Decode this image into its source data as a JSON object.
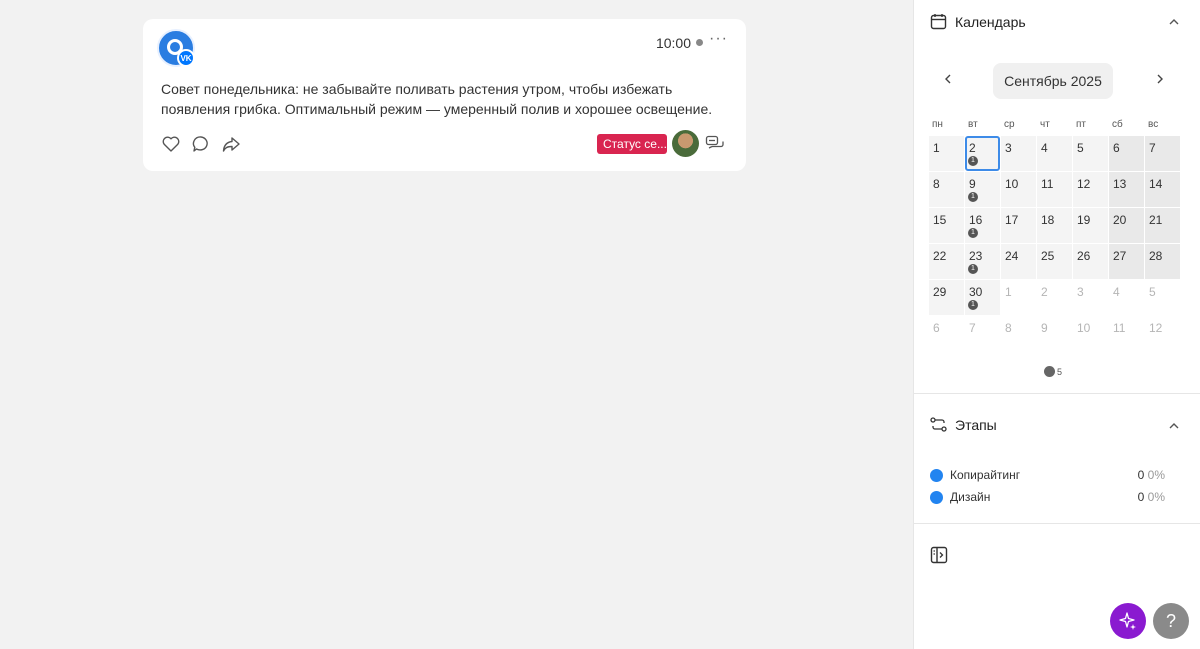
{
  "post": {
    "time": "10:00",
    "more_label": "···",
    "text": "Совет понедельника: не забывайте поливать растения утром, чтобы избежать появления грибка. Оптимальный режим — умеренный полив и хорошее освещение.",
    "status_label": "Статус се...",
    "network_badge": "VK"
  },
  "calendar": {
    "title": "Календарь",
    "month": "Сентябрь 2025",
    "weekdays": [
      "пн",
      "вт",
      "ср",
      "чт",
      "пт",
      "сб",
      "вс"
    ],
    "weeks": [
      [
        {
          "d": "1"
        },
        {
          "d": "2",
          "c": "1",
          "today": true
        },
        {
          "d": "3"
        },
        {
          "d": "4"
        },
        {
          "d": "5"
        },
        {
          "d": "6",
          "we": true
        },
        {
          "d": "7",
          "we": true
        }
      ],
      [
        {
          "d": "8"
        },
        {
          "d": "9",
          "c": "1"
        },
        {
          "d": "10"
        },
        {
          "d": "11"
        },
        {
          "d": "12"
        },
        {
          "d": "13",
          "we": true
        },
        {
          "d": "14",
          "we": true
        }
      ],
      [
        {
          "d": "15"
        },
        {
          "d": "16",
          "c": "1"
        },
        {
          "d": "17"
        },
        {
          "d": "18"
        },
        {
          "d": "19"
        },
        {
          "d": "20",
          "we": true
        },
        {
          "d": "21",
          "we": true
        }
      ],
      [
        {
          "d": "22"
        },
        {
          "d": "23",
          "c": "1"
        },
        {
          "d": "24"
        },
        {
          "d": "25"
        },
        {
          "d": "26"
        },
        {
          "d": "27",
          "we": true
        },
        {
          "d": "28",
          "we": true
        }
      ],
      [
        {
          "d": "29"
        },
        {
          "d": "30",
          "c": "1"
        },
        {
          "d": "1",
          "o": true
        },
        {
          "d": "2",
          "o": true
        },
        {
          "d": "3",
          "o": true
        },
        {
          "d": "4",
          "o": true
        },
        {
          "d": "5",
          "o": true
        }
      ],
      [
        {
          "d": "6",
          "o": true
        },
        {
          "d": "7",
          "o": true
        },
        {
          "d": "8",
          "o": true
        },
        {
          "d": "9",
          "o": true
        },
        {
          "d": "10",
          "o": true
        },
        {
          "d": "11",
          "o": true
        },
        {
          "d": "12",
          "o": true
        }
      ]
    ],
    "legend_count": "5"
  },
  "stages": {
    "title": "Этапы",
    "items": [
      {
        "label": "Копирайтинг",
        "count": "0",
        "pct": "0%"
      },
      {
        "label": "Дизайн",
        "count": "0",
        "pct": "0%"
      }
    ]
  },
  "buttons": {
    "help": "?"
  },
  "colors": {
    "accent": "#2284f0",
    "status": "#d92550",
    "ai": "#8a1ad0"
  }
}
